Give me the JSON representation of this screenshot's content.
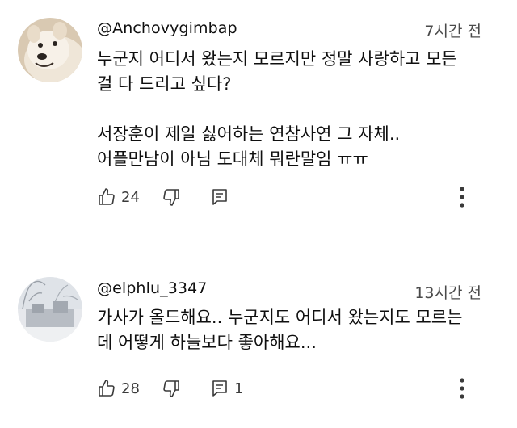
{
  "comments": [
    {
      "author": "@Anchovygimbap",
      "time": "7시간 전",
      "avatar_icon": "white-dog-avatar",
      "lines": [
        "누군지 어디서 왔는지 모르지만 정말 사랑하고 모든",
        "걸 다 드리고 싶다?",
        "",
        "서장훈이 제일 싫어하는 연참사연 그 자체..",
        "어플만남이 아님 도대체 뭐란말임 ㅠㅠ"
      ],
      "likes": "24",
      "replies": ""
    },
    {
      "author": "@elphlu_3347",
      "time": "13시간 전",
      "avatar_icon": "snowy-landscape-avatar",
      "lines": [
        "가사가 올드해요.. 누군지도 어디서 왔는지도 모르는",
        "데 어떻게 하늘보다 좋아해요..."
      ],
      "likes": "28",
      "replies": "1"
    }
  ],
  "icons": {
    "like": "thumb-up-icon",
    "dislike": "thumb-down-icon",
    "reply": "reply-icon",
    "more": "more-vert-icon"
  },
  "colors": {
    "text": "#0f0f0f",
    "secondary": "#4a4a4a",
    "icon": "#3a3a3a"
  }
}
